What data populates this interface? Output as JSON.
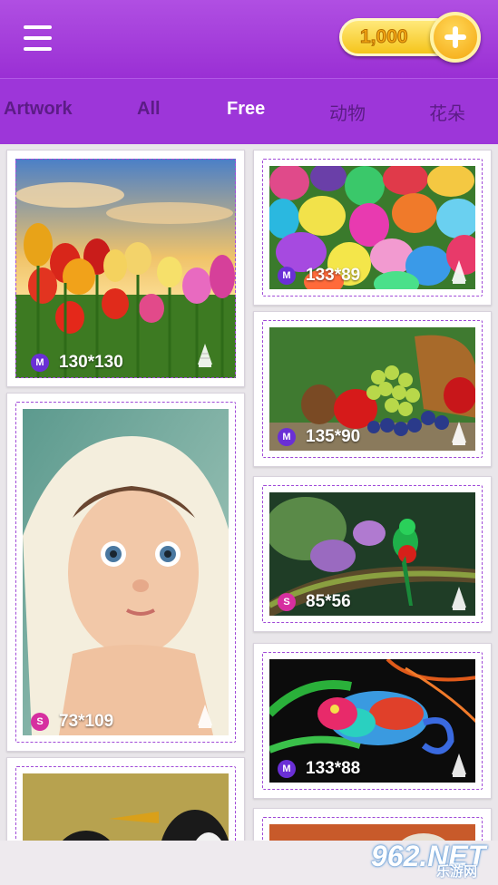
{
  "header": {
    "menu_icon": "hamburger-menu-icon",
    "coins": "1,000",
    "add_coins_icon": "plus-icon"
  },
  "tabs": [
    {
      "label": "Artwork"
    },
    {
      "label": "All"
    },
    {
      "label": "Free",
      "active": true
    },
    {
      "label": "动物"
    },
    {
      "label": "花朵"
    }
  ],
  "cards": [
    {
      "size": "130*130",
      "badge": "M",
      "badge_color": "#6a2fd6",
      "subject": "tulips-at-sunset"
    },
    {
      "size": "73*109",
      "badge": "S",
      "badge_color": "#d62fa0",
      "subject": "baby-in-towel"
    },
    {
      "size": "133*89",
      "badge": "M",
      "badge_color": "#6a2fd6",
      "subject": "easter-eggs"
    },
    {
      "size": "135*90",
      "badge": "M",
      "badge_color": "#6a2fd6",
      "subject": "fruit-basket"
    },
    {
      "size": "85*56",
      "badge": "S",
      "badge_color": "#d62fa0",
      "subject": "quetzal-bird"
    },
    {
      "size": "133*88",
      "badge": "M",
      "badge_color": "#6a2fd6",
      "subject": "chameleon"
    }
  ],
  "watermark": {
    "main": "962.NET",
    "sub": "乐游网"
  },
  "colors": {
    "header": "#a43ee0",
    "tab_active": "#ffffff",
    "tab_inactive": "#5c1c86",
    "frame": "#a04ad8"
  }
}
